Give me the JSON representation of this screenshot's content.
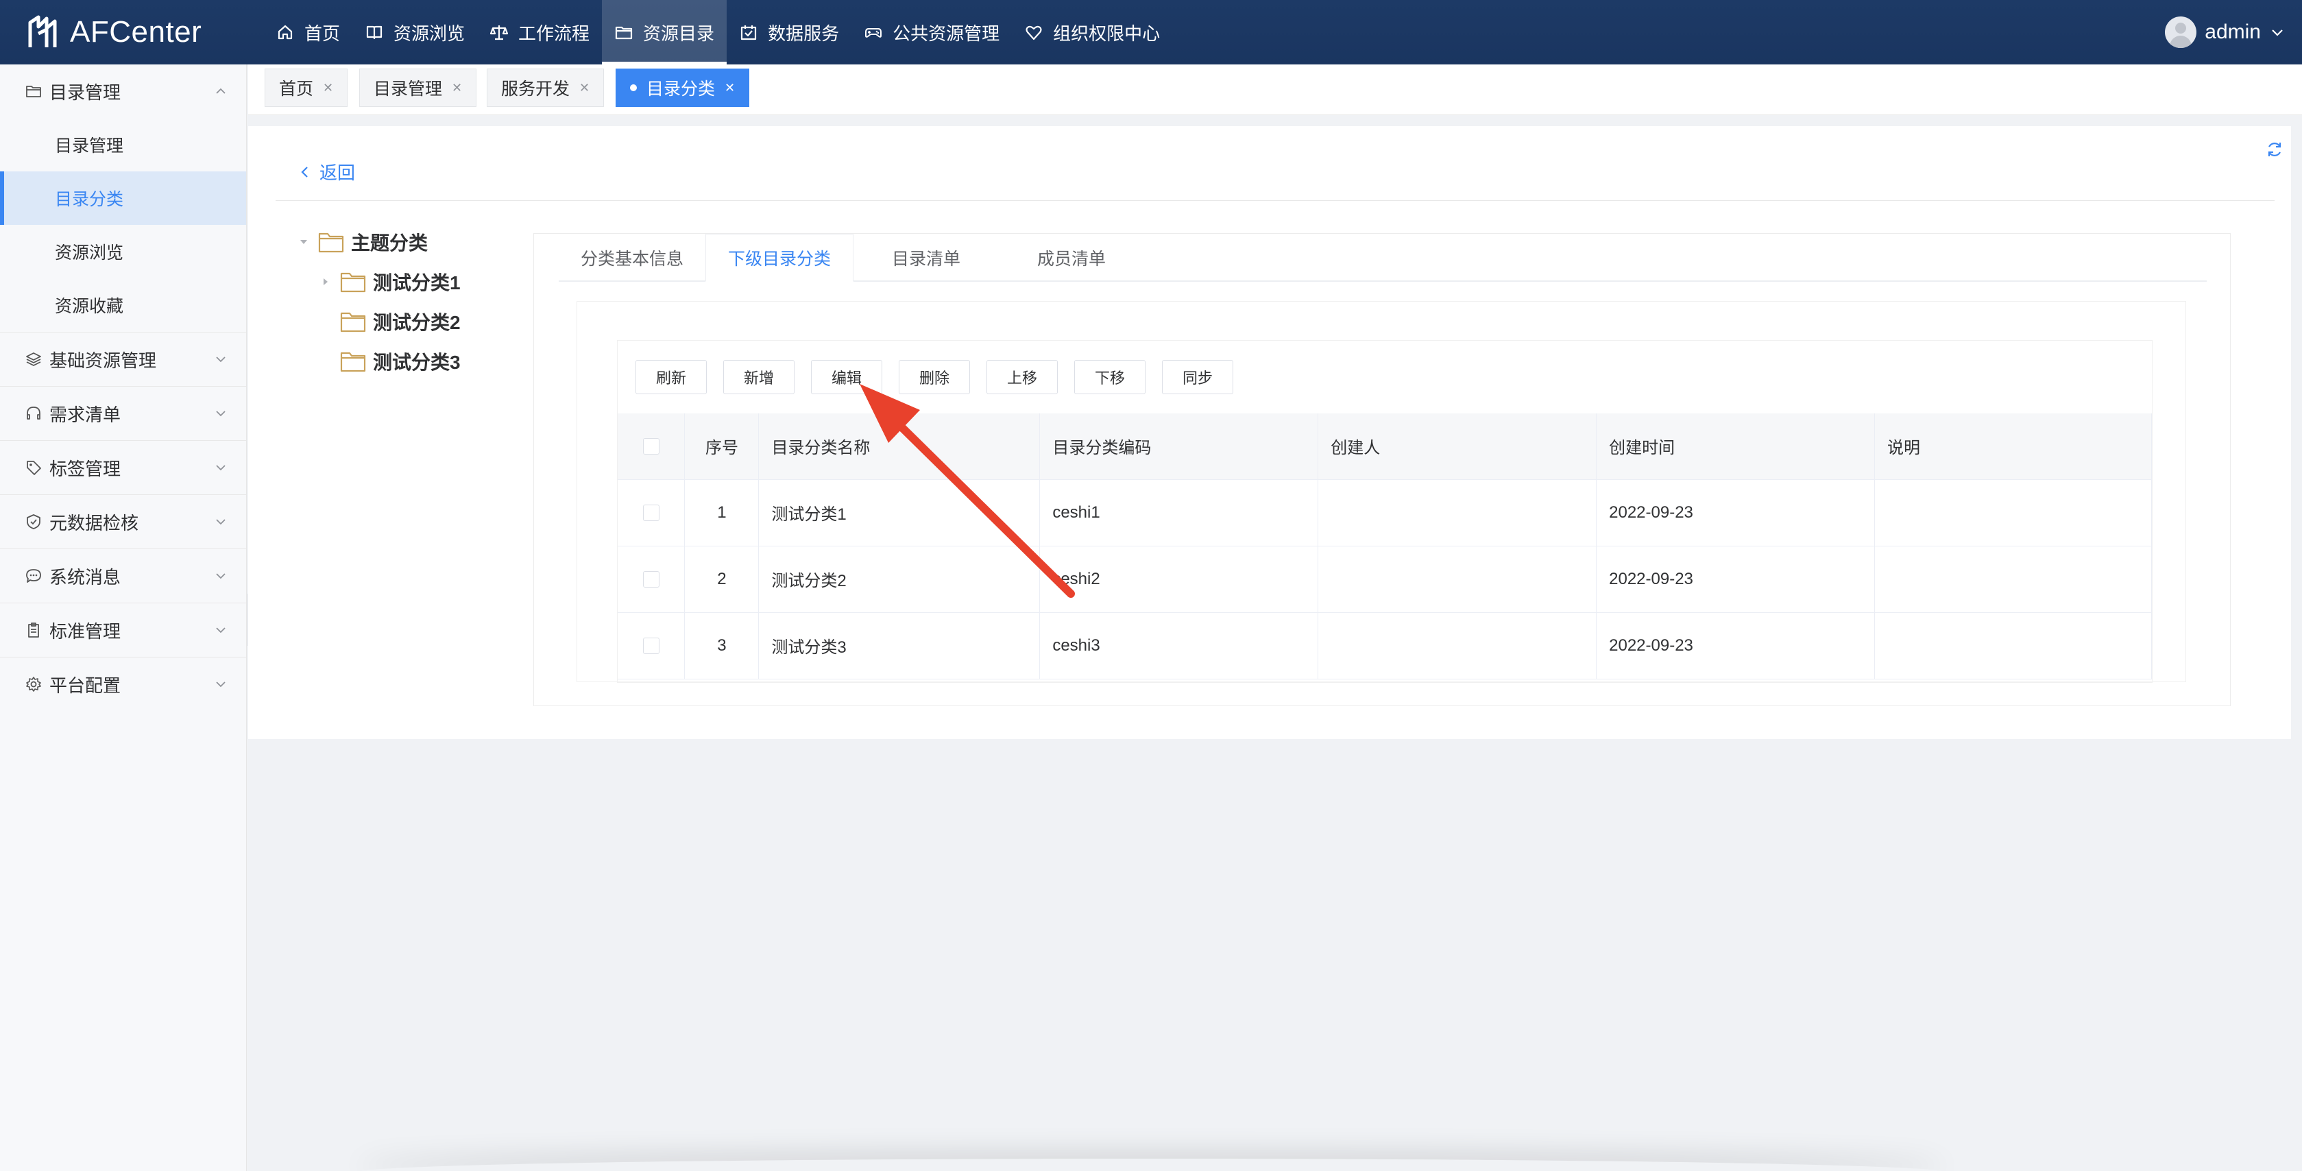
{
  "app": {
    "name": "AFCenter"
  },
  "topnav": [
    {
      "label": "首页",
      "icon": "home-icon"
    },
    {
      "label": "资源浏览",
      "icon": "book-icon"
    },
    {
      "label": "工作流程",
      "icon": "scale-icon"
    },
    {
      "label": "资源目录",
      "icon": "folder-icon",
      "active": true
    },
    {
      "label": "数据服务",
      "icon": "calendar-check-icon"
    },
    {
      "label": "公共资源管理",
      "icon": "gamepad-icon"
    },
    {
      "label": "组织权限中心",
      "icon": "heart-shield-icon"
    }
  ],
  "user": {
    "name": "admin"
  },
  "sidebar": {
    "groups": [
      {
        "label": "目录管理",
        "icon": "folder-icon",
        "expanded": true,
        "items": [
          {
            "label": "目录管理"
          },
          {
            "label": "目录分类",
            "active": true
          },
          {
            "label": "资源浏览"
          },
          {
            "label": "资源收藏"
          }
        ]
      },
      {
        "label": "基础资源管理",
        "icon": "layers-icon"
      },
      {
        "label": "需求清单",
        "icon": "headset-icon"
      },
      {
        "label": "标签管理",
        "icon": "tag-icon"
      },
      {
        "label": "元数据检核",
        "icon": "shield-check-icon"
      },
      {
        "label": "系统消息",
        "icon": "chat-icon"
      },
      {
        "label": "标准管理",
        "icon": "clipboard-icon"
      },
      {
        "label": "平台配置",
        "icon": "gear-icon"
      }
    ]
  },
  "page_tabs": [
    {
      "label": "首页"
    },
    {
      "label": "目录管理"
    },
    {
      "label": "服务开发"
    },
    {
      "label": "目录分类",
      "active": true
    }
  ],
  "back": {
    "label": "返回"
  },
  "tree": {
    "root": "主题分类",
    "children": [
      "测试分类1",
      "测试分类2",
      "测试分类3"
    ]
  },
  "inner_tabs": [
    {
      "label": "分类基本信息"
    },
    {
      "label": "下级目录分类",
      "active": true
    },
    {
      "label": "目录清单"
    },
    {
      "label": "成员清单"
    }
  ],
  "toolbar": {
    "refresh": "刷新",
    "add": "新增",
    "edit": "编辑",
    "delete": "删除",
    "move_up": "上移",
    "move_down": "下移",
    "sync": "同步"
  },
  "table": {
    "columns": [
      "序号",
      "目录分类名称",
      "目录分类编码",
      "创建人",
      "创建时间",
      "说明"
    ],
    "rows": [
      [
        "1",
        "测试分类1",
        "ceshi1",
        "",
        "2022-09-23",
        ""
      ],
      [
        "2",
        "测试分类2",
        "ceshi2",
        "",
        "2022-09-23",
        ""
      ],
      [
        "3",
        "测试分类3",
        "ceshi3",
        "",
        "2022-09-23",
        ""
      ]
    ]
  },
  "colors": {
    "topbar": "#1d3a66",
    "accent": "#3a86f2",
    "annotation_arrow": "#e8412c",
    "folder": "#c9a25a"
  }
}
